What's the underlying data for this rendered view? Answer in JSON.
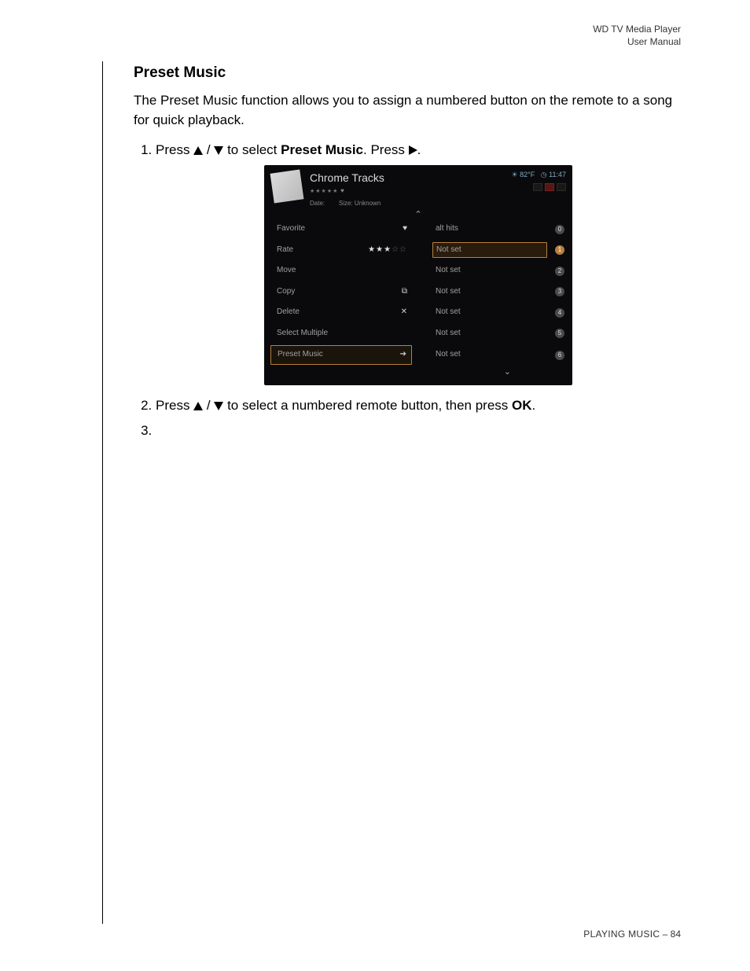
{
  "header": {
    "product": "WD TV Media Player",
    "doc": "User Manual"
  },
  "section": {
    "title": "Preset Music",
    "intro": "The Preset Music function allows you to assign a numbered button on the remote to a song for quick playback."
  },
  "steps": {
    "s1_a": "Press ",
    "s1_b": " to select ",
    "s1_bold": "Preset Music",
    "s1_c": ". Press ",
    "s1_d": ".",
    "s2_a": "Press ",
    "s2_b": " to select a numbered remote button, then press ",
    "s2_bold": "OK",
    "s2_c": ".",
    "slash": " / "
  },
  "ui": {
    "title": "Chrome Tracks",
    "date_label": "Date:",
    "size_label": "Size: Unknown",
    "temp": "82°F",
    "time": "11:47",
    "menu": {
      "favorite": "Favorite",
      "rate": "Rate",
      "move": "Move",
      "copy": "Copy",
      "delete": "Delete",
      "select_multiple": "Select Multiple",
      "preset_music": "Preset Music"
    },
    "right_vals": {
      "r0": "alt hits",
      "r1": "Not set",
      "r2": "Not set",
      "r3": "Not set",
      "r4": "Not set",
      "r5": "Not set",
      "r6": "Not set"
    },
    "badges": {
      "b0": "0",
      "b1": "1",
      "b2": "2",
      "b3": "3",
      "b4": "4",
      "b5": "5",
      "b6": "6"
    },
    "stars_filled": "★★★",
    "stars_empty": "☆☆"
  },
  "footer": {
    "section": "PLAYING MUSIC",
    "sep": " – ",
    "page": "84"
  }
}
